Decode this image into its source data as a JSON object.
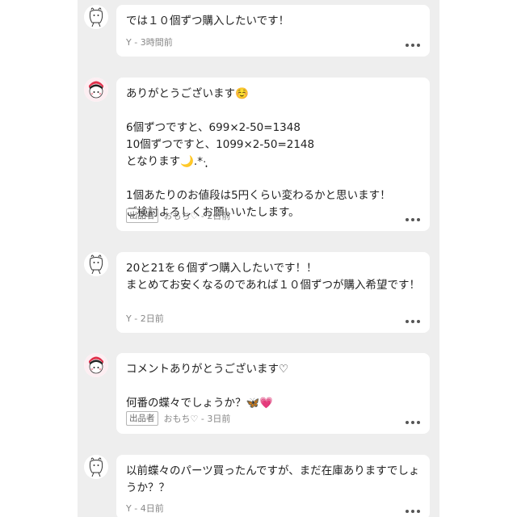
{
  "comments": [
    {
      "text": "では１０個ずつ購入したいです！",
      "author": "Y",
      "time": "3時間前",
      "seller": false
    },
    {
      "text": "ありがとうございます☺️\n\n6個ずつですと、699×2-50=1348\n10個ずつですと、1099×2-50=2148\nとなります🌙.*·̩͙\n\n1個あたりのお値段は5円くらい変わるかと思います！\nご検討よろしくお願いいたします。",
      "author": "おもち♡",
      "time": "2日前",
      "seller": true
    },
    {
      "text": "20と21を６個ずつ購入したいです！！\nまとめてお安くなるのであれば１０個ずつが購入希望です！",
      "author": "Y",
      "time": "2日前",
      "seller": false
    },
    {
      "text": "コメントありがとうございます♡\n\n何番の蝶々でしょうか？🦋💗",
      "author": "おもち♡",
      "time": "3日前",
      "seller": true
    },
    {
      "text": "以前蝶々のパーツ買ったんですが、まだ在庫ありますでしょうか？？",
      "author": "Y",
      "time": "4日前",
      "seller": false
    }
  ],
  "labels": {
    "seller_badge": "出品者",
    "separator": " - "
  }
}
